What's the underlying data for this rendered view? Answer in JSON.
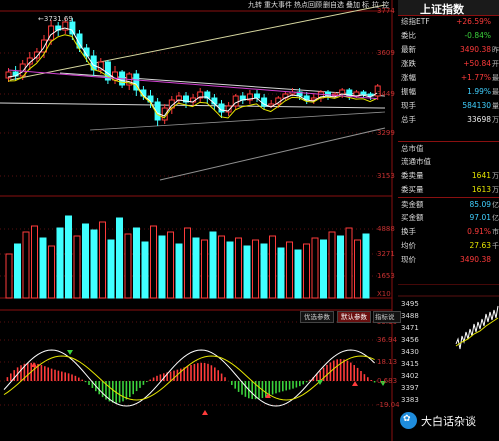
{
  "toolbar": {
    "items": [
      "九转",
      "重大事件",
      "热点回顾",
      "删自选",
      "叠加",
      "标",
      "拉",
      "控"
    ]
  },
  "chart": {
    "high_marker": "3731.69",
    "price_scale": [
      "3774",
      "3609",
      "3449",
      "3299",
      "3153"
    ],
    "volume_scale": [
      "4888",
      "3271",
      "1653",
      "X10"
    ],
    "indicator_scale": [
      "55.30",
      "36.94",
      "18.13",
      "0.683",
      "-19.04"
    ],
    "indicator_buttons": [
      "优选参数",
      "默认参数",
      "指标说明"
    ]
  },
  "panel": {
    "title": "上证指数",
    "rows": [
      {
        "label": "综指ETF",
        "value": "+26.59%",
        "color": "red"
      },
      {
        "label": "委比",
        "value": "-0.84%",
        "color": "grn"
      },
      {
        "label": "最新",
        "value": "3490.38",
        "color": "red",
        "unit": "昨"
      },
      {
        "label": "涨跌",
        "value": "+50.84",
        "color": "red",
        "unit": "开"
      },
      {
        "label": "涨幅",
        "value": "+1.77%",
        "color": "red",
        "unit": "最"
      },
      {
        "label": "振幅",
        "value": "1.99%",
        "color": "cyn",
        "unit": "最"
      },
      {
        "label": "现手",
        "value": "584130",
        "color": "cyn",
        "unit": "量"
      },
      {
        "label": "总手",
        "value": "33698",
        "color": "wht",
        "unit": "万 金"
      },
      {
        "label": "总市值",
        "value": "",
        "color": "wht"
      },
      {
        "label": "流通市值",
        "value": "",
        "color": "wht"
      },
      {
        "label": "委卖量",
        "value": "1641",
        "color": "yel",
        "unit": "万 委"
      },
      {
        "label": "委买量",
        "value": "1613",
        "color": "yel",
        "unit": "万 平"
      },
      {
        "label": "卖金额",
        "value": "85.09",
        "color": "cyn",
        "unit": "亿 买"
      },
      {
        "label": "买金额",
        "value": "97.01",
        "color": "cyn",
        "unit": "亿 市"
      },
      {
        "label": "换手",
        "value": "0.91%",
        "color": "red",
        "unit": "市"
      },
      {
        "label": "均价",
        "value": "27.63",
        "color": "yel",
        "unit": "千"
      },
      {
        "label": "现价",
        "value": "3490.38",
        "color": "red",
        "unit": ""
      }
    ],
    "mini_scale": [
      "3495",
      "3488",
      "3471",
      "3456",
      "3430",
      "3415",
      "3402",
      "3397",
      "3383"
    ]
  },
  "watermark": "大白话杂谈",
  "colors": {
    "up": "#ff3b3b",
    "down": "#40ffff",
    "bg": "#000000",
    "grid": "#8a1010"
  }
}
